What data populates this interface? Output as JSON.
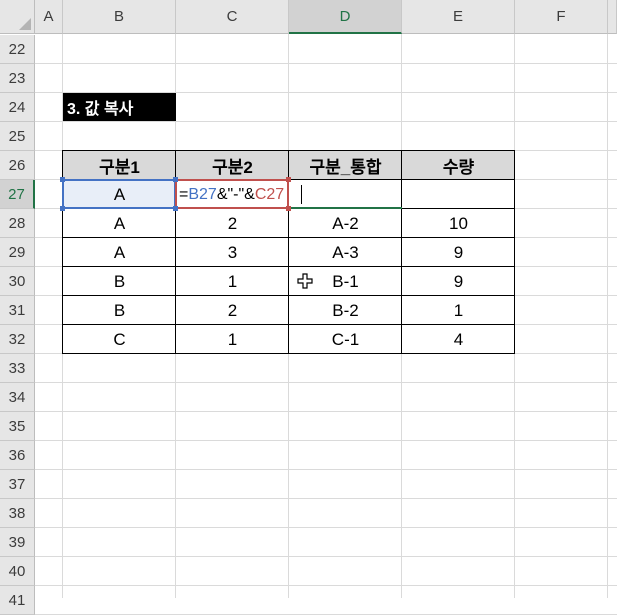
{
  "columns": [
    "A",
    "B",
    "C",
    "D",
    "E",
    "F"
  ],
  "rows": [
    "22",
    "23",
    "24",
    "25",
    "26",
    "27",
    "28",
    "29",
    "30",
    "31",
    "32",
    "33",
    "34",
    "35",
    "36",
    "37",
    "38",
    "39",
    "40",
    "41"
  ],
  "title": "3. 값 복사",
  "table": {
    "headers": [
      "구분1",
      "구분2",
      "구분_통합",
      "수량"
    ],
    "rows": [
      [
        "A",
        "2",
        "A-2",
        "10"
      ],
      [
        "A",
        "3",
        "A-3",
        "9"
      ],
      [
        "B",
        "1",
        "B-1",
        "9"
      ],
      [
        "B",
        "2",
        "B-2",
        "1"
      ],
      [
        "C",
        "1",
        "C-1",
        "4"
      ]
    ]
  },
  "active_row": {
    "b_value": "A",
    "formula_parts": [
      {
        "text": "=",
        "color": "#000000"
      },
      {
        "text": "B27",
        "color": "#4472c4"
      },
      {
        "text": "&\"-\"&",
        "color": "#000000"
      },
      {
        "text": "C27",
        "color": "#c0504d"
      }
    ]
  },
  "colors": {
    "header_bg": "#e6e6e6",
    "selected_header_text": "#217346",
    "ref_blue": "#4472c4",
    "ref_red": "#c0504d",
    "table_header_bg": "#d9d9d9"
  },
  "icons": {
    "cursor": "cell-cross-cursor-icon"
  }
}
